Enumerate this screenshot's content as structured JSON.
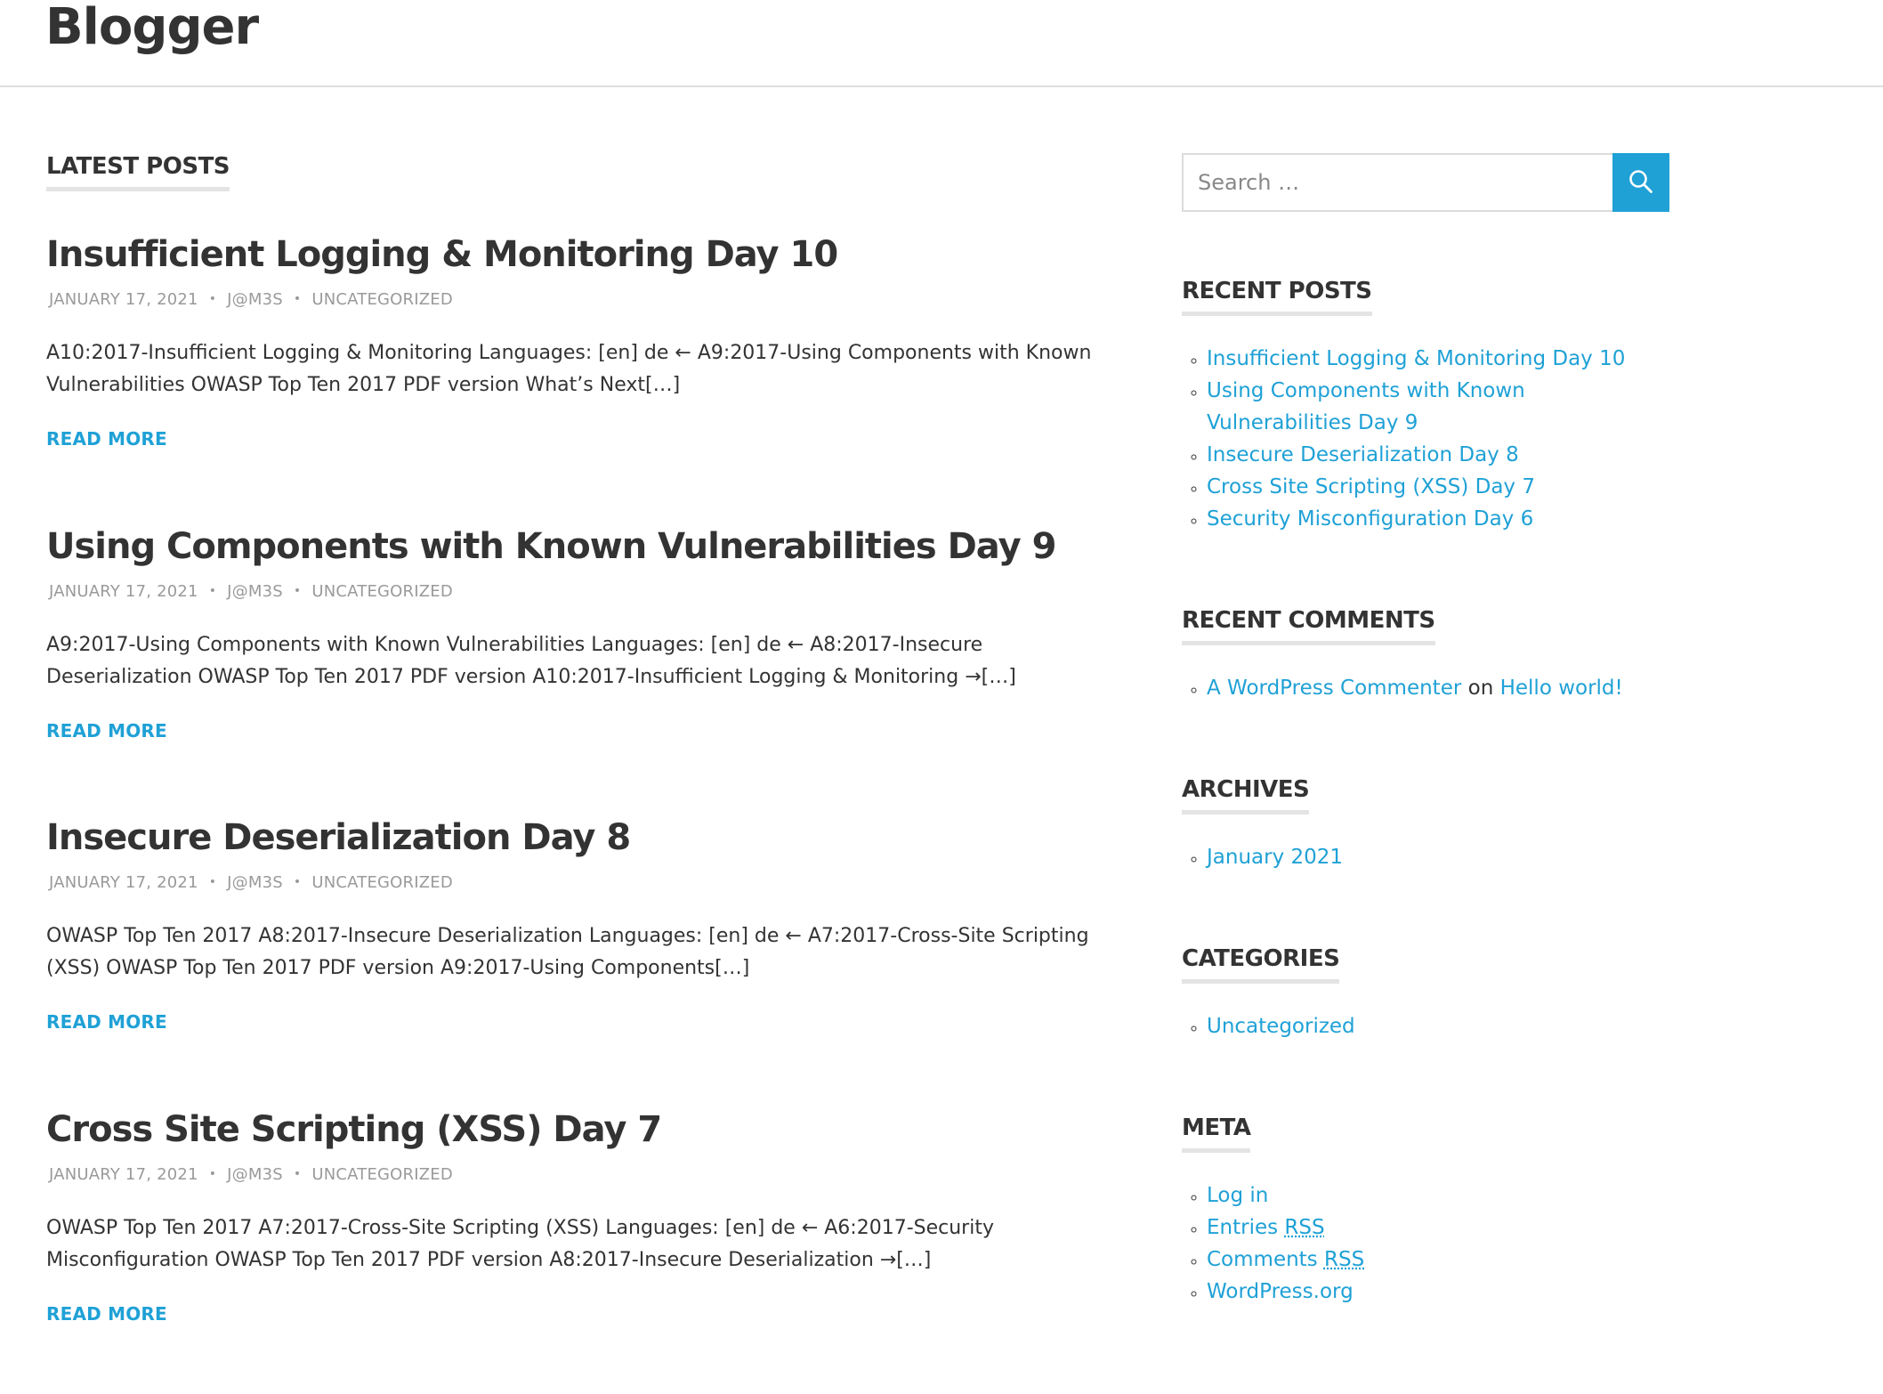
{
  "site": {
    "title": "Blogger"
  },
  "colors": {
    "accent": "#1fa1d6",
    "text": "#333333",
    "meta": "#9a9a9a"
  },
  "main": {
    "heading": "LATEST POSTS",
    "posts": [
      {
        "title": "Insufficient Logging & Monitoring Day 10",
        "date": "JANUARY 17, 2021",
        "author": "J@M3S",
        "category": "UNCATEGORIZED",
        "excerpt": "A10:2017-Insufficient Logging & Monitoring Languages: [en] de ← A9:2017-Using Components with Known Vulnerabilities OWASP Top Ten 2017 PDF version What’s Next[…]",
        "read_more": "READ MORE"
      },
      {
        "title": "Using Components with Known Vulnerabilities Day 9",
        "date": "JANUARY 17, 2021",
        "author": "J@M3S",
        "category": "UNCATEGORIZED",
        "excerpt": "A9:2017-Using Components with Known Vulnerabilities Languages: [en] de ← A8:2017-Insecure Deserialization OWASP Top Ten 2017 PDF version A10:2017-Insufficient Logging & Monitoring →[…]",
        "read_more": "READ MORE"
      },
      {
        "title": "Insecure Deserialization Day 8",
        "date": "JANUARY 17, 2021",
        "author": "J@M3S",
        "category": "UNCATEGORIZED",
        "excerpt": "OWASP Top Ten 2017 A8:2017-Insecure Deserialization Languages: [en] de ← A7:2017-Cross-Site Scripting (XSS) OWASP Top Ten 2017 PDF version A9:2017-Using Components[…]",
        "read_more": "READ MORE"
      },
      {
        "title": "Cross Site Scripting (XSS) Day 7",
        "date": "JANUARY 17, 2021",
        "author": "J@M3S",
        "category": "UNCATEGORIZED",
        "excerpt": "OWASP Top Ten 2017 A7:2017-Cross-Site Scripting (XSS) Languages: [en] de ← A6:2017-Security Misconfiguration OWASP Top Ten 2017 PDF version A8:2017-Insecure Deserialization →[…]",
        "read_more": "READ MORE"
      }
    ]
  },
  "sidebar": {
    "search": {
      "placeholder": "Search …",
      "icon": "search-icon"
    },
    "recent_posts": {
      "title": "RECENT POSTS",
      "items": [
        "Insufficient Logging & Monitoring Day 10",
        "Using Components with Known Vulnerabilities Day 9",
        "Insecure Deserialization Day 8",
        "Cross Site Scripting (XSS) Day 7",
        "Security Misconfiguration Day 6"
      ]
    },
    "recent_comments": {
      "title": "RECENT COMMENTS",
      "items": [
        {
          "author": "A WordPress Commenter",
          "on": "on",
          "post": "Hello world!"
        }
      ]
    },
    "archives": {
      "title": "ARCHIVES",
      "items": [
        "January 2021"
      ]
    },
    "categories": {
      "title": "CATEGORIES",
      "items": [
        "Uncategorized"
      ]
    },
    "meta": {
      "title": "META",
      "log_in": "Log in",
      "entries_label": "Entries",
      "comments_label": "Comments",
      "rss_abbr": "RSS",
      "wordpress_org": "WordPress.org"
    }
  }
}
